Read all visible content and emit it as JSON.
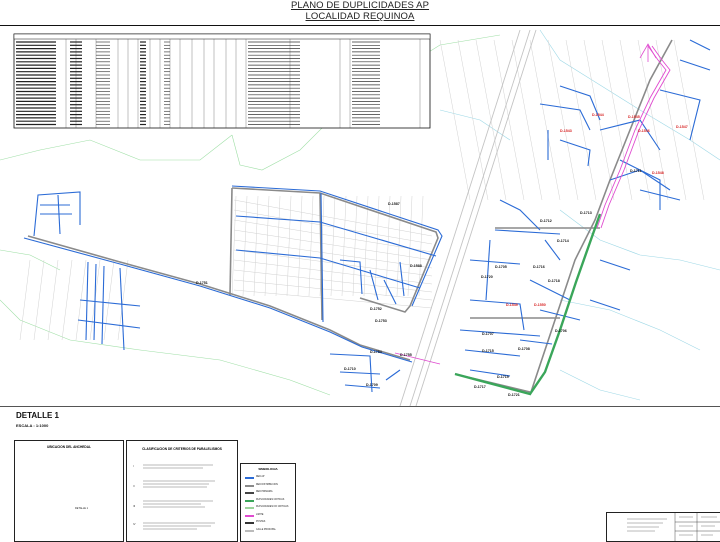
{
  "title": {
    "line1": "PLANO DE DUPLICIDADES AP",
    "line2": "LOCALIDAD REQUINOA"
  },
  "detail": {
    "title": "DETALLE 1",
    "scale": "ESCALA : 1:1000"
  },
  "location_panel": {
    "title": "UBICACION DEL ANCHEDAL",
    "tag": "DETALLE 1"
  },
  "criteria_panel": {
    "title": "CLASIFICACION DE CRITERIOS DE PARALELISMOS",
    "roman": [
      "I",
      "II",
      "III",
      "IV"
    ]
  },
  "legend": {
    "title": "SIMBOLOGIA",
    "items": [
      {
        "label": "RED AP",
        "color": "#2b6bd6"
      },
      {
        "label": "RED DISTRIBUCION",
        "color": "#8a8a8a"
      },
      {
        "label": "RED PRIMARIA",
        "color": "#444444"
      },
      {
        "label": "DUPLICIDADES CRITICAS",
        "color": "#3aa65a"
      },
      {
        "label": "DUPLICIDADES NO CRITICAS",
        "color": "#9bd49b"
      },
      {
        "label": "LIMITE",
        "color": "#e04bd0"
      },
      {
        "label": "POSTES",
        "color": "#333333"
      },
      {
        "label": "CALLE PRINCIPAL",
        "color": "#bbbbbb"
      }
    ]
  },
  "duplicity_labels_black": [
    "D-1587",
    "D-1588",
    "D-1751",
    "D-1752",
    "D-1753",
    "D-1754",
    "D-1755",
    "D-1709",
    "D-1710",
    "D-1711",
    "D-1712",
    "D-1713",
    "D-1714",
    "D-1716",
    "D-1718",
    "D-1720",
    "D-1705",
    "D-1706",
    "D-1707",
    "D-1708",
    "D-1715",
    "D-1717",
    "D-1719",
    "D-1721"
  ],
  "duplicity_labels_red": [
    "D-1543",
    "D-1544",
    "D-1545",
    "D-1546",
    "D-1547",
    "D-1548",
    "D-1549",
    "D-1550"
  ],
  "colors": {
    "ap_network": "#2b6bd6",
    "grey_network": "#888888",
    "critical": "#3aa65a",
    "boundary": "#e04bd0",
    "rail": "#cfcfcf",
    "green_outline": "#9fdfa6",
    "cyan_outline": "#9ed8e6"
  }
}
